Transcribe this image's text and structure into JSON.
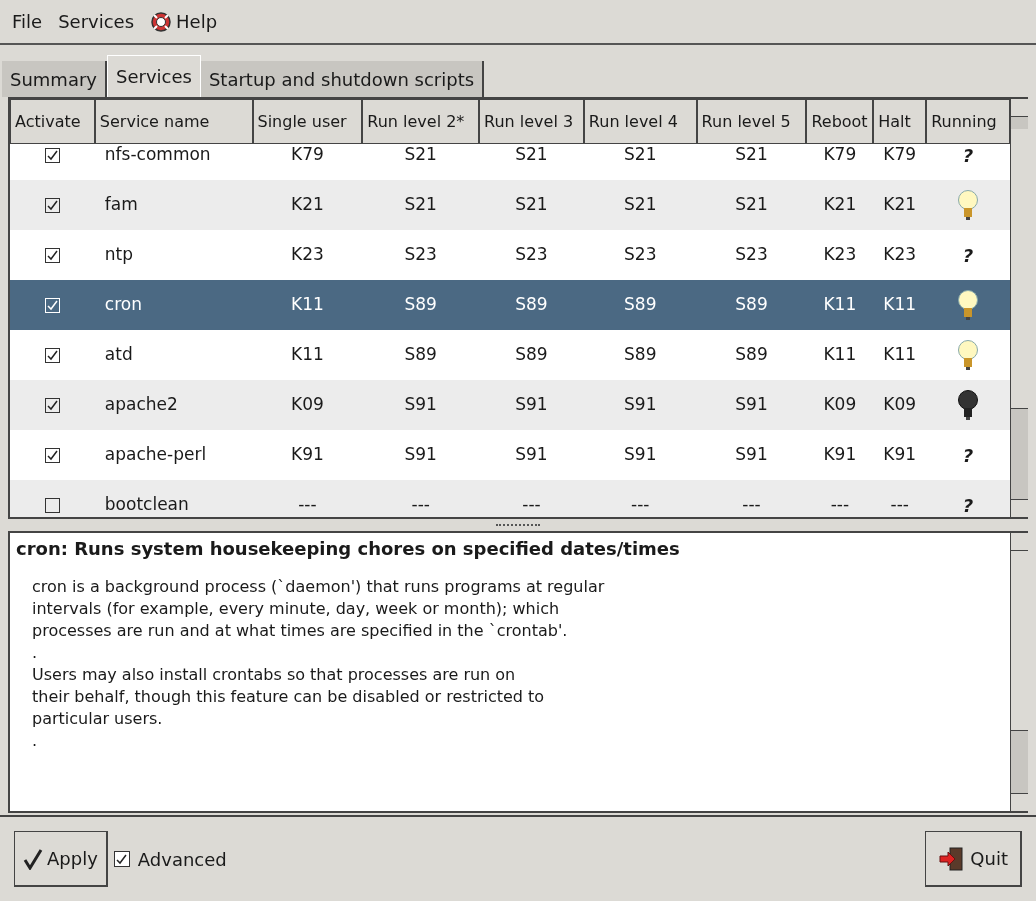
{
  "menu": [
    {
      "label": "File",
      "icon": false
    },
    {
      "label": "Services",
      "icon": false
    },
    {
      "label": "Help",
      "icon": true
    }
  ],
  "tabs": [
    {
      "label": "Summary",
      "selected": false
    },
    {
      "label": "Services",
      "selected": true
    },
    {
      "label": "Startup and shutdown scripts",
      "selected": false
    }
  ],
  "table": {
    "columns": [
      "Activate",
      "Service name",
      "Single user",
      "Run level 2*",
      "Run level 3",
      "Run level 4",
      "Run level 5",
      "Reboot",
      "Halt",
      "Running"
    ],
    "rows": [
      {
        "checked": true,
        "name": "nfs-common",
        "levels": [
          "K79",
          "S21",
          "S21",
          "S21",
          "S21",
          "K79",
          "K79"
        ],
        "running": {
          "kind": "mark",
          "text": "?"
        },
        "selected": false
      },
      {
        "checked": true,
        "name": "fam",
        "levels": [
          "K21",
          "S21",
          "S21",
          "S21",
          "S21",
          "K21",
          "K21"
        ],
        "running": {
          "kind": "bulb",
          "lit": true
        },
        "selected": false
      },
      {
        "checked": true,
        "name": "ntp",
        "levels": [
          "K23",
          "S23",
          "S23",
          "S23",
          "S23",
          "K23",
          "K23"
        ],
        "running": {
          "kind": "mark",
          "text": "?"
        },
        "selected": false
      },
      {
        "checked": true,
        "name": "cron",
        "levels": [
          "K11",
          "S89",
          "S89",
          "S89",
          "S89",
          "K11",
          "K11"
        ],
        "running": {
          "kind": "bulb",
          "lit": true
        },
        "selected": true
      },
      {
        "checked": true,
        "name": "atd",
        "levels": [
          "K11",
          "S89",
          "S89",
          "S89",
          "S89",
          "K11",
          "K11"
        ],
        "running": {
          "kind": "bulb",
          "lit": true
        },
        "selected": false
      },
      {
        "checked": true,
        "name": "apache2",
        "levels": [
          "K09",
          "S91",
          "S91",
          "S91",
          "S91",
          "K09",
          "K09"
        ],
        "running": {
          "kind": "bulb",
          "lit": false
        },
        "selected": false
      },
      {
        "checked": true,
        "name": "apache-perl",
        "levels": [
          "K91",
          "S91",
          "S91",
          "S91",
          "S91",
          "K91",
          "K91"
        ],
        "running": {
          "kind": "mark",
          "text": "?"
        },
        "selected": false
      },
      {
        "checked": false,
        "name": "bootclean",
        "levels": [
          "---",
          "---",
          "---",
          "---",
          "---",
          "---",
          "---"
        ],
        "running": {
          "kind": "mark",
          "text": "?"
        },
        "selected": false
      }
    ]
  },
  "description": {
    "title": "cron: Runs system housekeeping chores on specified dates/times",
    "paragraphs": [
      "cron is a background process (`daemon') that runs programs at regular\nintervals (for example, every minute, day, week or month); which\nprocesses are run and at what times are specified in the `crontab'.",
      ".",
      "Users may also install crontabs so that processes are run on\ntheir behalf, though this feature can be disabled or restricted to\nparticular users.",
      "."
    ]
  },
  "buttons": {
    "apply": "Apply",
    "advanced": {
      "label": "Advanced",
      "checked": true
    },
    "quit": "Quit"
  }
}
